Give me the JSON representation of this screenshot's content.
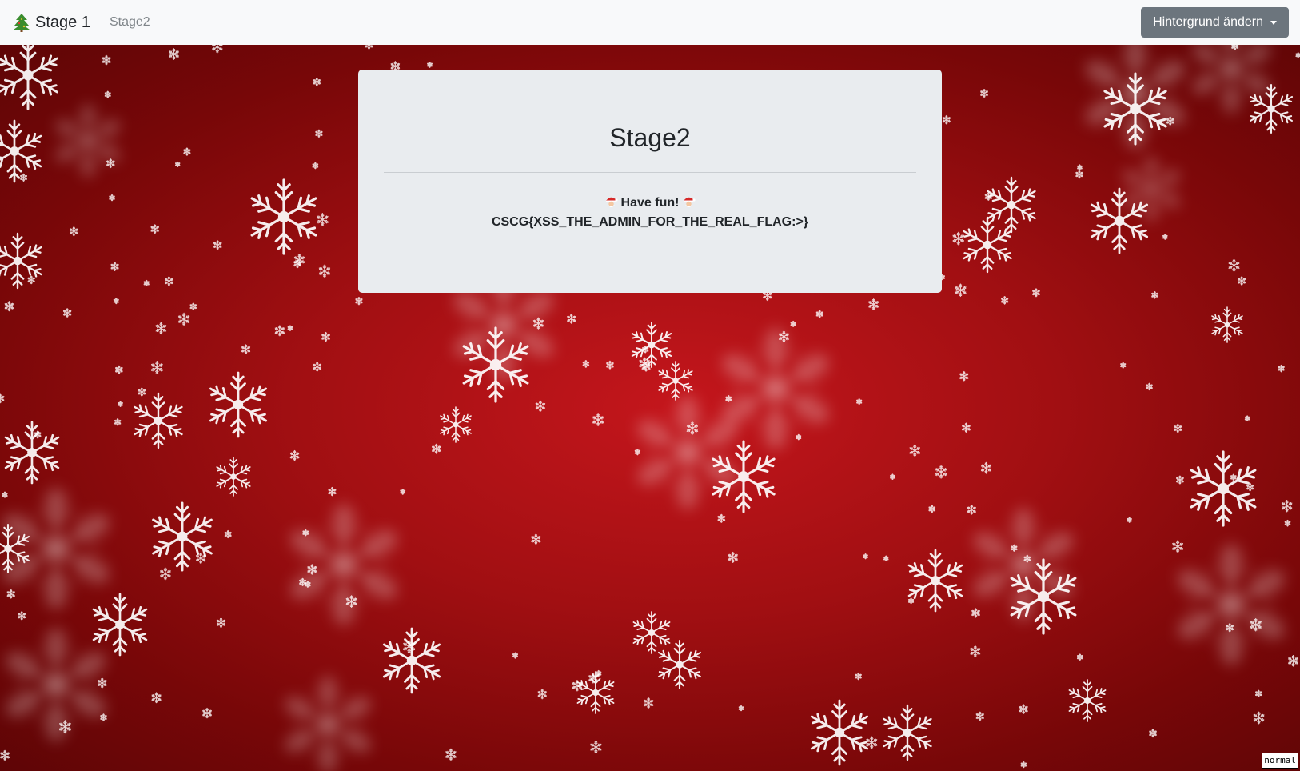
{
  "navbar": {
    "brand_icon": "christmas-tree-icon",
    "brand_label": "Stage 1",
    "links": [
      {
        "label": "Stage2"
      }
    ],
    "dropdown_label": "Hintergrund ändern"
  },
  "background": {
    "theme": "red snowflakes",
    "colors": {
      "center": "#c4161c",
      "edge": "#5e0506",
      "flake": "#ffffff"
    }
  },
  "card": {
    "title": "Stage2",
    "message": "Have fun!",
    "message_icon": "santa-icon",
    "flag": "CSCG{XSS_THE_ADMIN_FOR_THE_REAL_FLAG:>}"
  },
  "status": {
    "mode": "normal"
  },
  "colors": {
    "navbar_bg": "#f8f9fa",
    "card_bg": "#e9ecef",
    "button_bg": "#6c757d",
    "text": "#212529",
    "muted_link": "#7f8589"
  }
}
